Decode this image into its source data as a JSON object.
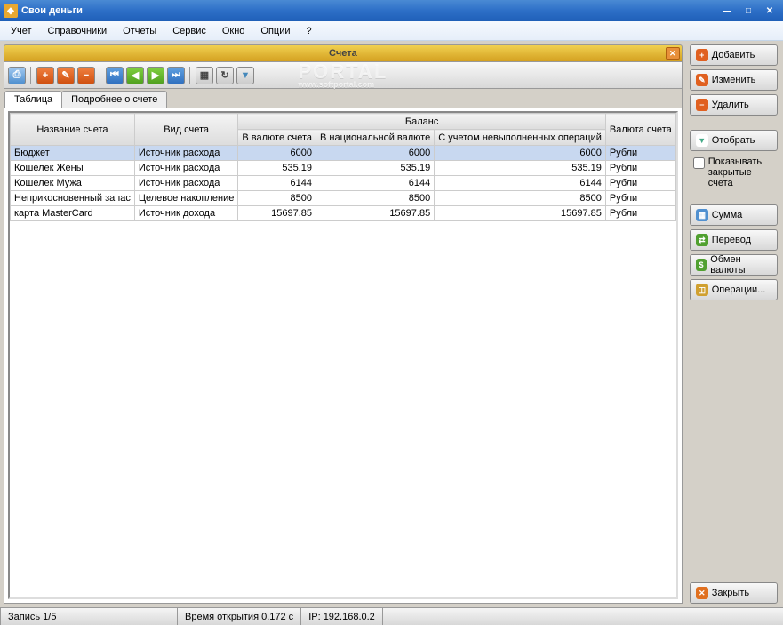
{
  "app": {
    "title": "Свои деньги"
  },
  "menu": {
    "items": [
      "Учет",
      "Справочники",
      "Отчеты",
      "Сервис",
      "Окно",
      "Опции",
      "?"
    ]
  },
  "child_window": {
    "title": "Счета"
  },
  "watermark": {
    "text": "PORTAL",
    "sub": "www.softportal.com"
  },
  "tabs": {
    "items": [
      "Таблица",
      "Подробнее о счете"
    ],
    "active": 0
  },
  "table": {
    "headers": {
      "name": "Название счета",
      "type": "Вид счета",
      "balance": "Баланс",
      "bal_currency": "В валюте счета",
      "bal_national": "В национальной валюте",
      "bal_pending": "С учетом невыполненных операций",
      "currency": "Валюта счета"
    },
    "rows": [
      {
        "name": "Бюджет",
        "type": "Источник расхода",
        "bc": "6000",
        "bn": "6000",
        "bp": "6000",
        "cur": "Рубли",
        "selected": true
      },
      {
        "name": "Кошелек Жены",
        "type": "Источник расхода",
        "bc": "535.19",
        "bn": "535.19",
        "bp": "535.19",
        "cur": "Рубли"
      },
      {
        "name": "Кошелек Мужа",
        "type": "Источник расхода",
        "bc": "6144",
        "bn": "6144",
        "bp": "6144",
        "cur": "Рубли"
      },
      {
        "name": "Неприкосновенный запас",
        "type": "Целевое накопление",
        "bc": "8500",
        "bn": "8500",
        "bp": "8500",
        "cur": "Рубли"
      },
      {
        "name": "карта MasterCard",
        "type": "Источник дохода",
        "bc": "15697.85",
        "bn": "15697.85",
        "bp": "15697.85",
        "cur": "Рубли"
      }
    ]
  },
  "sidebar": {
    "add": "Добавить",
    "edit": "Изменить",
    "delete": "Удалить",
    "filter": "Отобрать",
    "show_closed": "Показывать закрытые счета",
    "sum": "Сумма",
    "transfer": "Перевод",
    "exchange": "Обмен валюты",
    "operations": "Операции...",
    "close": "Закрыть"
  },
  "status": {
    "record": "Запись 1/5",
    "open_time": "Время открытия 0.172 с",
    "ip": "IP: 192.168.0.2"
  }
}
